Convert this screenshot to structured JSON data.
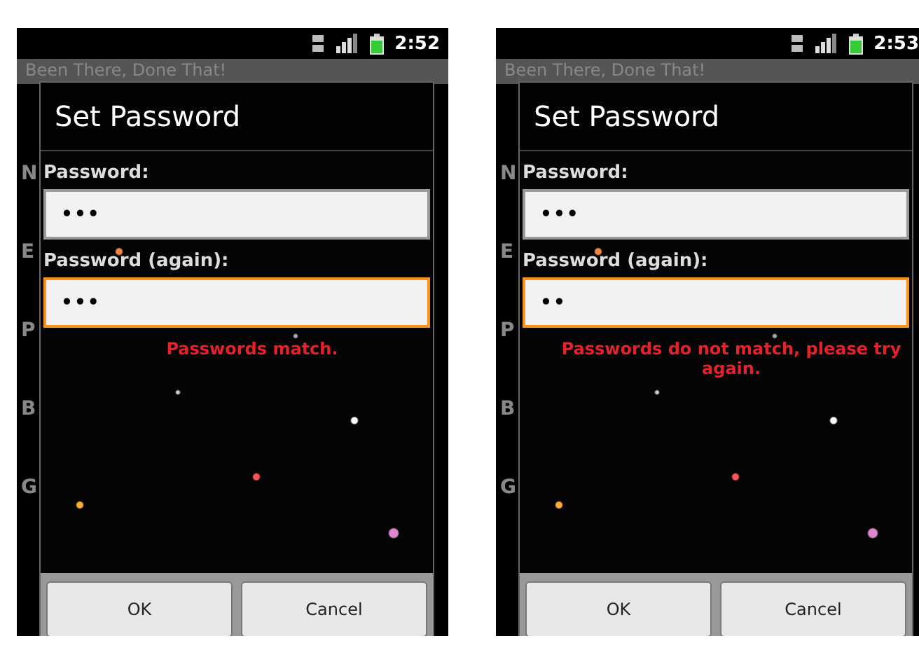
{
  "phones": [
    {
      "status_bar": {
        "time": "2:52"
      },
      "app_title": "Been There, Done That!",
      "background_letters": [
        "N",
        "E",
        "P",
        "B",
        "G"
      ],
      "dialog": {
        "title": "Set Password",
        "fields": [
          {
            "label": "Password:",
            "value": "•••",
            "focused": false
          },
          {
            "label": "Password (again):",
            "value": "•••",
            "focused": true
          }
        ],
        "message": "Passwords match.",
        "buttons": [
          "OK",
          "Cancel"
        ]
      }
    },
    {
      "status_bar": {
        "time": "2:53"
      },
      "app_title": "Been There, Done That!",
      "background_letters": [
        "N",
        "E",
        "P",
        "B",
        "G"
      ],
      "dialog": {
        "title": "Set Password",
        "fields": [
          {
            "label": "Password:",
            "value": "•••",
            "focused": false
          },
          {
            "label": "Password (again):",
            "value": "••",
            "focused": true
          }
        ],
        "message": "Passwords do not match, please try again.",
        "buttons": [
          "OK",
          "Cancel"
        ]
      }
    }
  ]
}
